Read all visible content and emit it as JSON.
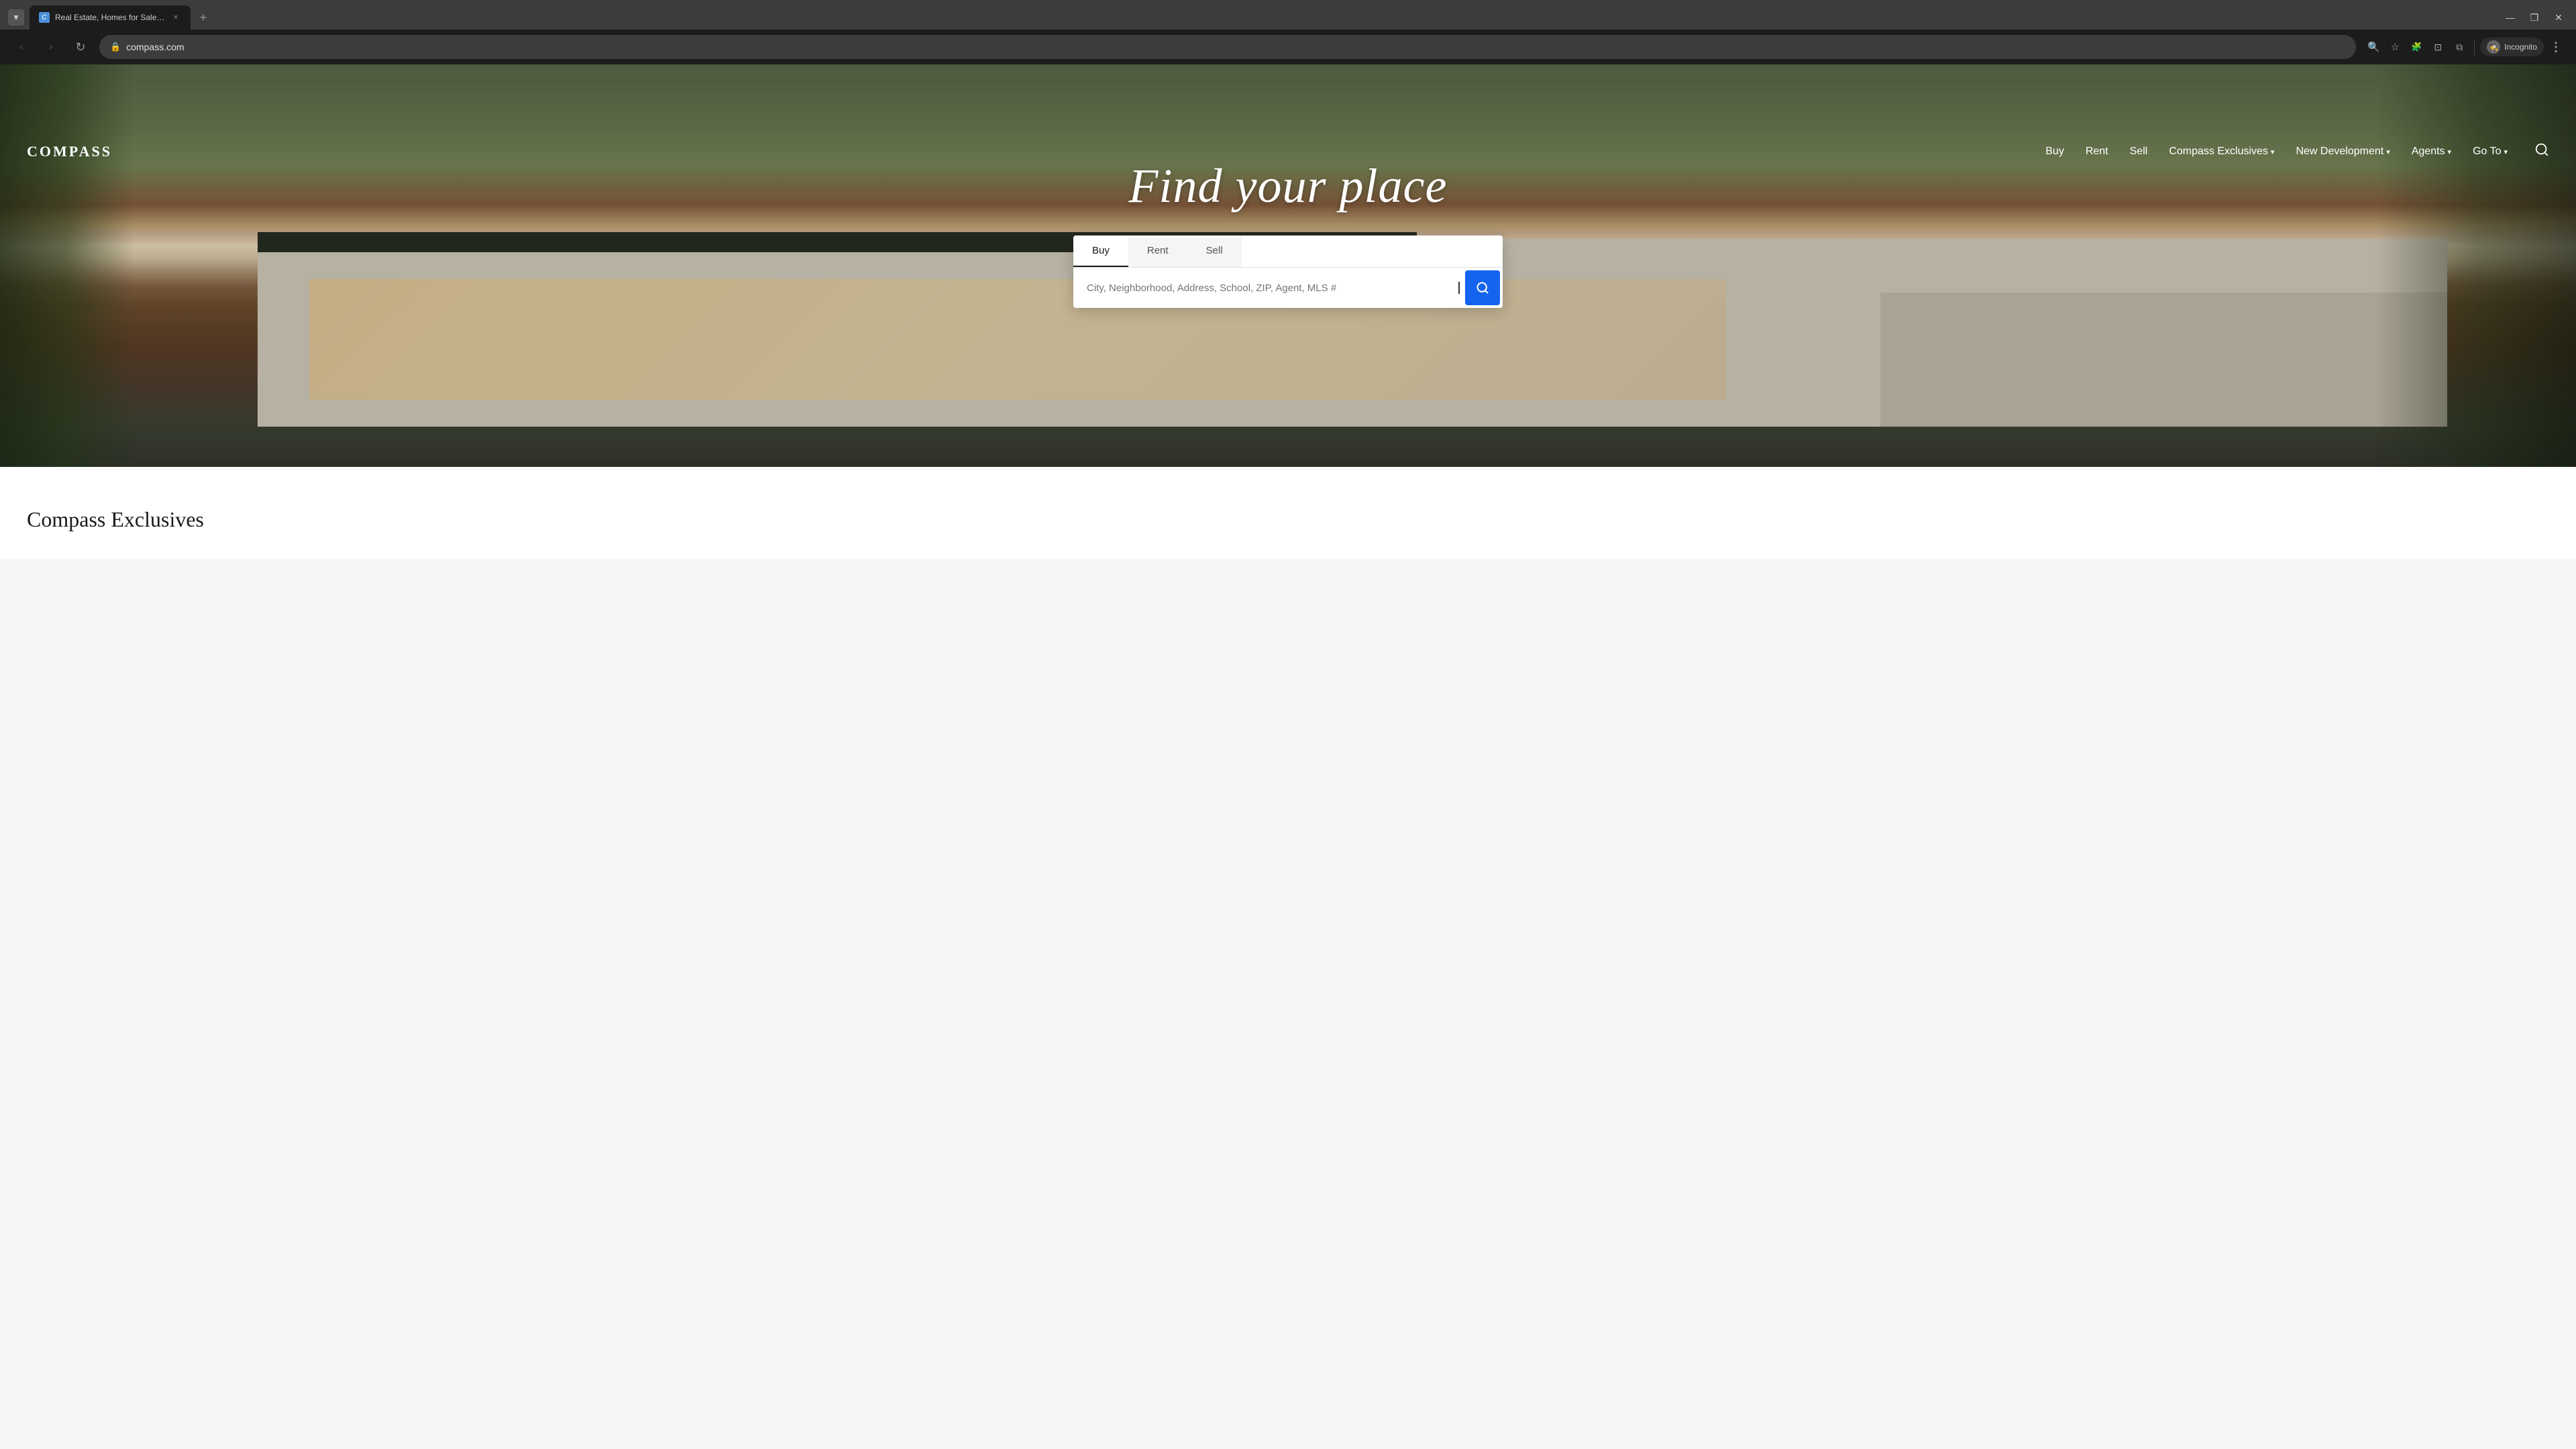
{
  "browser": {
    "tab": {
      "favicon_label": "C",
      "title": "Real Estate, Homes for Sale & A",
      "close": "×"
    },
    "tab_new": "+",
    "window_controls": {
      "minimize": "—",
      "restore": "❐",
      "close": "✕"
    },
    "nav": {
      "back": "‹",
      "forward": "›",
      "refresh": "↻",
      "url": "compass.com"
    },
    "address_actions": {
      "search": "🔍",
      "star": "☆",
      "extensions": "🧩",
      "profile": "⊡"
    },
    "incognito": {
      "icon": "🕵",
      "label": "Incognito"
    },
    "more": "⋮"
  },
  "site": {
    "logo": "COMPASS",
    "nav": {
      "buy": "Buy",
      "rent": "Rent",
      "sell": "Sell",
      "compass_exclusives": "Compass Exclusives",
      "new_development": "New Development",
      "agents": "Agents",
      "go_to": "Go To"
    },
    "hero": {
      "title": "Find your place",
      "search_tabs": [
        "Buy",
        "Rent",
        "Sell"
      ],
      "active_tab": "Buy",
      "search_placeholder": "City, Neighborhood, Address, School, ZIP, Agent, MLS #",
      "search_button_icon": "🔍"
    },
    "below_hero": {
      "section_title": "Compass Exclusives"
    }
  }
}
